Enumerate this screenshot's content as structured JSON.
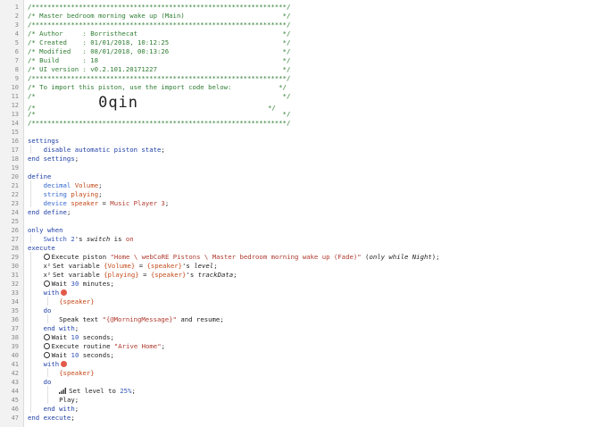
{
  "editor": {
    "colors": {
      "comment": "#2e7d32",
      "keyword": "#1f3fa6",
      "type": "#3366cc",
      "variable": "#c44a1a",
      "string": "#b03a2e",
      "number": "#3355bb",
      "gutter": "#f2f2f2"
    },
    "lines": [
      {
        "num": "1",
        "text": "/*****************************************************************/"
      },
      {
        "num": "2",
        "text": "/* Master bedroom morning wake up (Main)                         */"
      },
      {
        "num": "3",
        "text": "/*****************************************************************/"
      },
      {
        "num": "4",
        "text": "/* Author     : Borristhecat                                     */"
      },
      {
        "num": "5",
        "text": "/* Created    : 01/01/2018, 10:12:25                             */"
      },
      {
        "num": "6",
        "text": "/* Modified   : 08/01/2018, 00:13:26                             */"
      },
      {
        "num": "7",
        "text": "/* Build      : 18                                               */"
      },
      {
        "num": "8",
        "text": "/* UI version : v0.2.101.20171227                                */"
      },
      {
        "num": "9",
        "text": "/*****************************************************************/"
      },
      {
        "num": "10",
        "text": "/* To import this piston, use the import code below:            */"
      },
      {
        "num": "11",
        "text": "/*                                                               */"
      },
      {
        "num": "12",
        "text_a": "/*                ",
        "code": "0qin",
        "text_b": "                                 */"
      },
      {
        "num": "13",
        "text": "/*                                                               */"
      },
      {
        "num": "14",
        "text": "/*****************************************************************/"
      },
      {
        "num": "15",
        "text": ""
      },
      {
        "num": "16",
        "kw": "settings"
      },
      {
        "num": "17",
        "indent": "    ",
        "kw": "disable automatic piston state",
        "tail": ";"
      },
      {
        "num": "18",
        "kw": "end settings",
        "tail": ";"
      },
      {
        "num": "19",
        "text": ""
      },
      {
        "num": "20",
        "kw": "define"
      },
      {
        "num": "21",
        "indent": "    ",
        "ty": "decimal",
        "var": "Volume",
        "tail": ";"
      },
      {
        "num": "22",
        "indent": "    ",
        "ty": "string",
        "var": "playing",
        "tail": ";"
      },
      {
        "num": "23",
        "indent": "    ",
        "ty": "device",
        "var": "speaker",
        "eq": " = ",
        "str": "Music Player 3",
        "tail": ";"
      },
      {
        "num": "24",
        "kw": "end define",
        "tail": ";"
      },
      {
        "num": "25",
        "text": ""
      },
      {
        "num": "26",
        "kw": "only when"
      },
      {
        "num": "27",
        "indent": "    ",
        "dev": "Switch 2",
        "mid": "'s ",
        "attr": "switch",
        "is": " is ",
        "val": "on"
      },
      {
        "num": "28",
        "kw": "execute"
      },
      {
        "num": "29",
        "indent": "    ",
        "icon": "clock",
        "a": "Execute piston ",
        "str": "\"Home \\ webCoRE Pistons \\ Master bedroom morning wake up (Fade)\"",
        "b": " (",
        "it": "only while Night",
        "c": ");"
      },
      {
        "num": "30",
        "indent": "    ",
        "icon": "x2",
        "a": "Set variable ",
        "var": "{Volume}",
        "b": " = ",
        "var2": "{speaker}",
        "c": "'s ",
        "it": "level",
        "d": ";"
      },
      {
        "num": "31",
        "indent": "    ",
        "icon": "x2",
        "a": "Set variable ",
        "var": "{playing}",
        "b": " = ",
        "var2": "{speaker}",
        "c": "'s ",
        "it": "trackData",
        "d": ";"
      },
      {
        "num": "32",
        "indent": "    ",
        "icon": "clock",
        "a": "Wait ",
        "n": "30",
        "b": " minutes;"
      },
      {
        "num": "33",
        "indent": "    ",
        "kw": "with",
        "icon2": "no"
      },
      {
        "num": "34",
        "indent": "        ",
        "var": "{speaker}"
      },
      {
        "num": "35",
        "indent": "    ",
        "kw": "do"
      },
      {
        "num": "36",
        "indent": "        ",
        "a": "Speak text ",
        "str": "\"{@MorningMessage}\"",
        "b": " and resume;"
      },
      {
        "num": "37",
        "indent": "    ",
        "kw": "end with",
        "tail": ";"
      },
      {
        "num": "38",
        "indent": "    ",
        "icon": "clock",
        "a": "Wait ",
        "n": "10",
        "b": " seconds;"
      },
      {
        "num": "39",
        "indent": "    ",
        "icon": "clock",
        "a": "Execute routine ",
        "str": "\"Arive Home\"",
        "b": ";"
      },
      {
        "num": "40",
        "indent": "    ",
        "icon": "clock",
        "a": "Wait ",
        "n": "10",
        "b": " seconds;"
      },
      {
        "num": "41",
        "indent": "    ",
        "kw": "with",
        "icon2": "no"
      },
      {
        "num": "42",
        "indent": "        ",
        "var": "{speaker}"
      },
      {
        "num": "43",
        "indent": "    ",
        "kw": "do"
      },
      {
        "num": "44",
        "indent": "        ",
        "icon": "sig",
        "a": "Set level to ",
        "n": "25%",
        "b": ";"
      },
      {
        "num": "45",
        "indent": "        ",
        "a": "Play;"
      },
      {
        "num": "46",
        "indent": "    ",
        "kw": "end with",
        "tail": ";"
      },
      {
        "num": "47",
        "kw": "end execute",
        "tail": ";"
      }
    ]
  }
}
